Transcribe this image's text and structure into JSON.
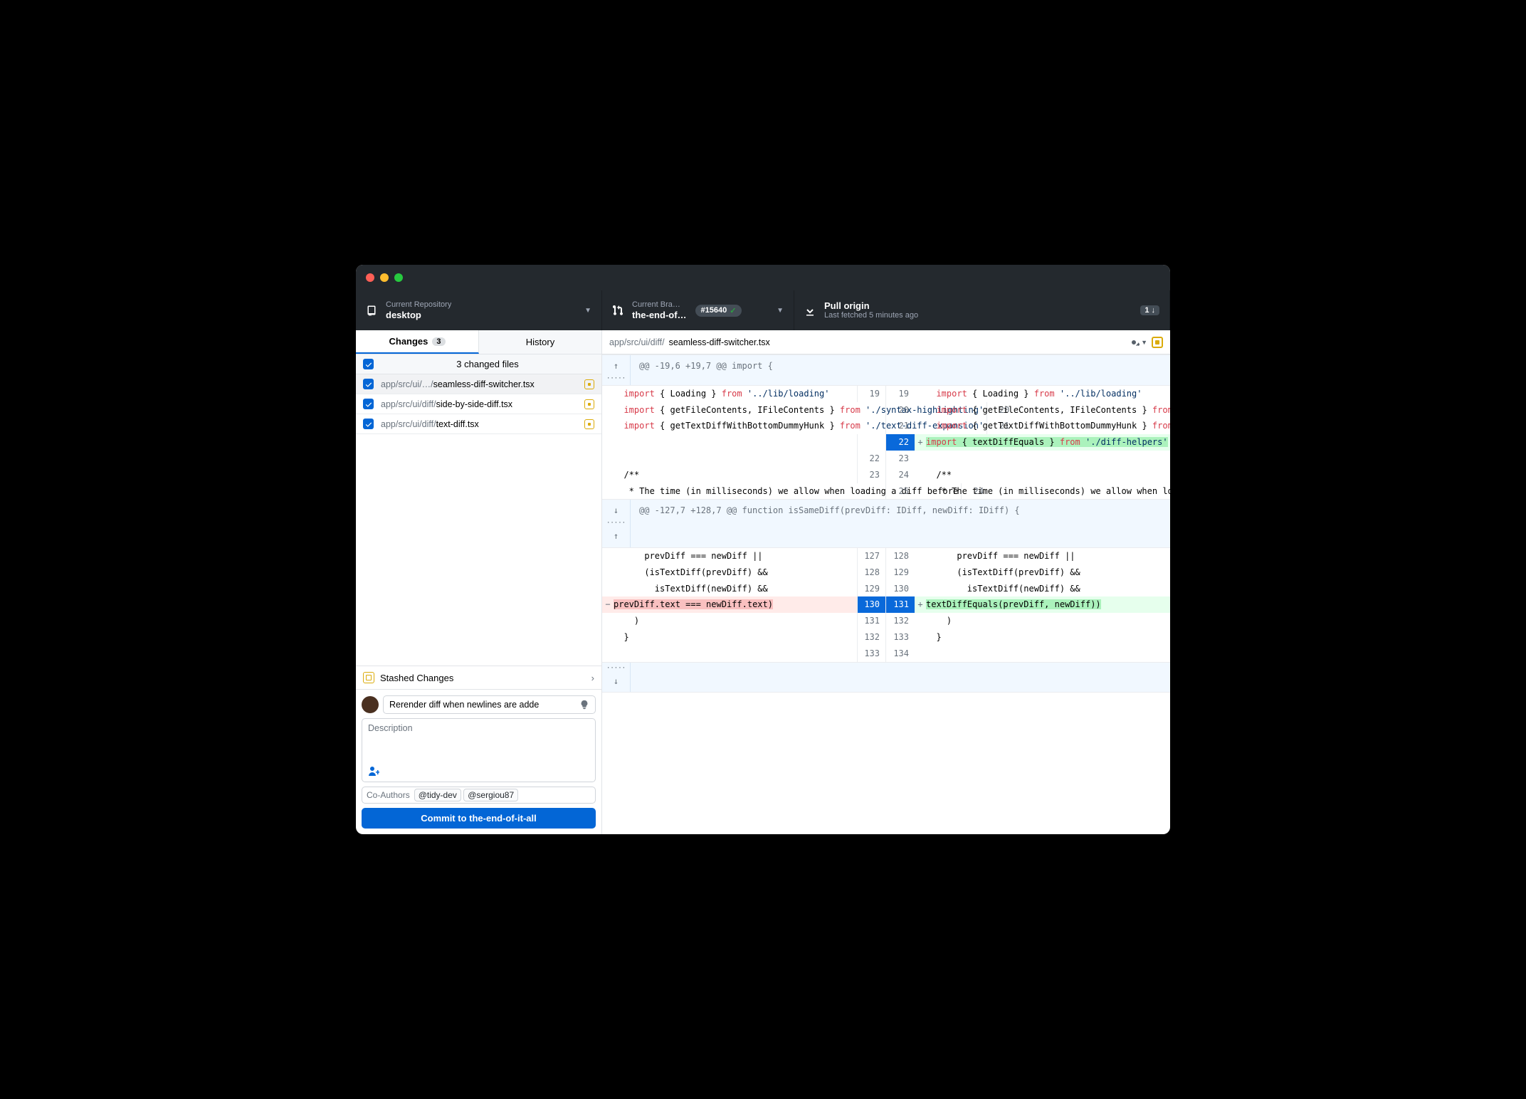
{
  "toolbar": {
    "repo": {
      "label": "Current Repository",
      "value": "desktop"
    },
    "branch": {
      "label": "Current Bra…",
      "value": "the-end-of…",
      "pr_number": "#15640"
    },
    "pull": {
      "label": "Pull origin",
      "value": "Last fetched 5 minutes ago",
      "count": "1 ↓"
    }
  },
  "sidebar": {
    "tabs": {
      "changes": "Changes",
      "changes_count": "3",
      "history": "History"
    },
    "files_summary": "3 changed files",
    "files": [
      {
        "dir": "app/src/ui/…/",
        "name": "seamless-diff-switcher.tsx",
        "selected": true
      },
      {
        "dir": "app/src/ui/diff/",
        "name": "side-by-side-diff.tsx",
        "selected": false
      },
      {
        "dir": "app/src/ui/diff/",
        "name": "text-diff.tsx",
        "selected": false
      }
    ],
    "stashed": "Stashed Changes",
    "commit": {
      "summary": "Rerender diff when newlines are adde",
      "description_placeholder": "Description",
      "coauthors_label": "Co-Authors",
      "coauthors": [
        "@tidy-dev",
        "@sergiou87"
      ],
      "button_prefix": "Commit to ",
      "button_branch": "the-end-of-it-all"
    }
  },
  "diff": {
    "path_dir": "app/src/ui/diff/",
    "path_file": "seamless-diff-switcher.tsx",
    "hunks": [
      {
        "header": "@@ -19,6 +19,7 @@ import {",
        "lines": [
          {
            "t": "ctx",
            "ol": "19",
            "nl": "19",
            "lh": "  import { Loading } from '../lib/loading'",
            "rh": "  import { Loading } from '../lib/loading'"
          },
          {
            "t": "ctx",
            "ol": "20",
            "nl": "20",
            "lh": "  import { getFileContents, IFileContents } from './syntax-highlighting'",
            "rh": "  import { getFileContents, IFileContents } from './syntax-highlighting'"
          },
          {
            "t": "ctx",
            "ol": "21",
            "nl": "21",
            "lh": "  import { getTextDiffWithBottomDummyHunk } from './text-diff-expansion'",
            "rh": "  import { getTextDiffWithBottomDummyHunk } from './text-diff-expansion'"
          },
          {
            "t": "add",
            "ol": "",
            "nl": "22",
            "lh": "",
            "rh": "+ import { textDiffEquals } from './diff-helpers'"
          },
          {
            "t": "ctx",
            "ol": "22",
            "nl": "23",
            "lh": "",
            "rh": ""
          },
          {
            "t": "ctx",
            "ol": "23",
            "nl": "24",
            "lh": "  /**",
            "rh": "  /**"
          },
          {
            "t": "ctx",
            "ol": "24",
            "nl": "25",
            "lh": "   * The time (in milliseconds) we allow when loading a diff before",
            "rh": "   * The time (in milliseconds) we allow when loading a diff before"
          }
        ]
      },
      {
        "header": "@@ -127,7 +128,7 @@ function isSameDiff(prevDiff: IDiff, newDiff: IDiff) {",
        "lines": [
          {
            "t": "ctx",
            "ol": "127",
            "nl": "128",
            "lh": "      prevDiff === newDiff ||",
            "rh": "      prevDiff === newDiff ||"
          },
          {
            "t": "ctx",
            "ol": "128",
            "nl": "129",
            "lh": "      (isTextDiff(prevDiff) &&",
            "rh": "      (isTextDiff(prevDiff) &&"
          },
          {
            "t": "ctx",
            "ol": "129",
            "nl": "130",
            "lh": "        isTextDiff(newDiff) &&",
            "rh": "        isTextDiff(newDiff) &&"
          },
          {
            "t": "chg",
            "ol": "130",
            "nl": "131",
            "lh": "-       prevDiff.text === newDiff.text)",
            "rh": "+       textDiffEquals(prevDiff, newDiff))"
          },
          {
            "t": "ctx",
            "ol": "131",
            "nl": "132",
            "lh": "    )",
            "rh": "    )"
          },
          {
            "t": "ctx",
            "ol": "132",
            "nl": "133",
            "lh": "  }",
            "rh": "  }"
          },
          {
            "t": "ctx",
            "ol": "133",
            "nl": "134",
            "lh": "",
            "rh": ""
          }
        ]
      }
    ]
  }
}
